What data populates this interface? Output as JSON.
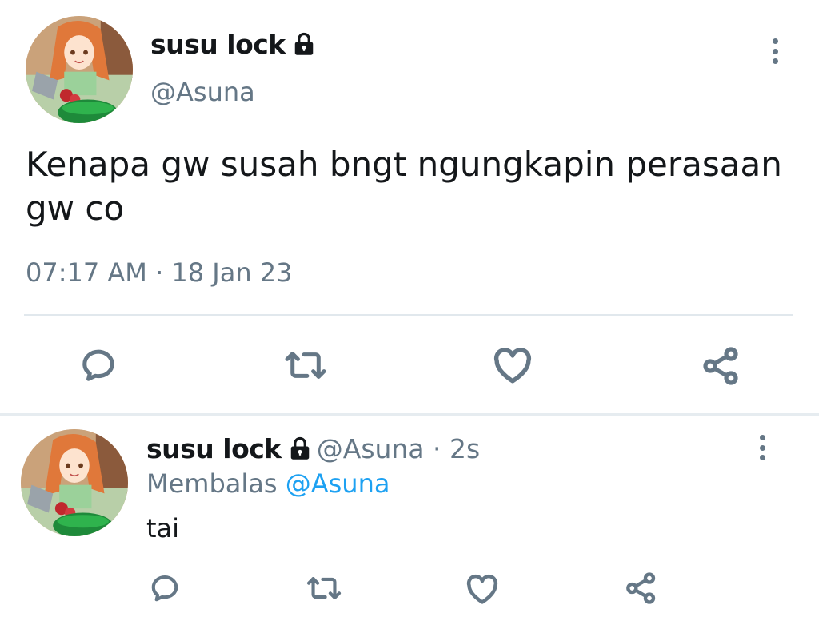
{
  "main_tweet": {
    "display_name": "susu lock",
    "protected_icon": "lock-icon",
    "handle": "@Asuna",
    "text": "Kenapa gw susah bngt ngungkapin perasaan gw co",
    "timestamp": "07:17 AM · 18 Jan 23",
    "menu_icon": "more-vertical-icon",
    "actions": [
      "reply-icon",
      "retweet-icon",
      "like-icon",
      "share-icon"
    ]
  },
  "reply_tweet": {
    "display_name": "susu lock",
    "protected_icon": "lock-icon",
    "handle_time": "@Asuna · 2s",
    "replying_label": "Membalas",
    "replying_mention": "@Asuna",
    "text": "tai",
    "menu_icon": "more-vertical-icon",
    "actions": [
      "reply-icon",
      "retweet-icon",
      "like-icon",
      "share-icon"
    ]
  },
  "colors": {
    "text_primary": "#14171a",
    "text_secondary": "#657786",
    "mention": "#1da1f2",
    "divider": "#e1e8ed"
  }
}
